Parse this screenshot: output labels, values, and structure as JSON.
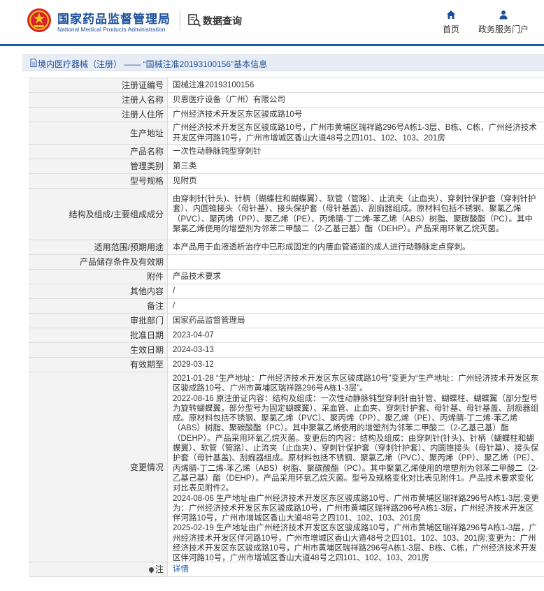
{
  "header": {
    "brand_cn": "国家药品监督管理局",
    "brand_en": "National Medical Products Administration",
    "data_query": "数据查询",
    "nav_home": "首页",
    "nav_service": "政务服务门户",
    "accent": "#1a4f9c"
  },
  "breadcrumb": "境内医疗器械（注册） —— “国械注准20193100156”基本信息",
  "rows": [
    {
      "label": "注册证编号",
      "value": "国械注准20193100156"
    },
    {
      "label": "注册人名称",
      "value": "贝恩医疗设备（广州）有限公司"
    },
    {
      "label": "注册人住所",
      "value": "广州经济技术开发区东区骏成路10号"
    },
    {
      "label": "生产地址",
      "value": "广州经济技术开发区东区骏成路10号，广州市黄埔区瑞祥路296号A栋1-3层、B栋、C栋，广州经济技术开发区伴河路10号，广州市增城区香山大道48号之四101、102、103、201房"
    },
    {
      "label": "产品名称",
      "value": "一次性动静脉钝型穿刺针"
    },
    {
      "label": "管理类别",
      "value": "第三类"
    },
    {
      "label": "型号规格",
      "value": "见附页"
    },
    {
      "label": "结构及组成/主要组成成分",
      "value": "由穿刺针(针头)、针柄（蝴蝶柱和蝴蝶翼）、软管（管路）、止流夹（止血夹）、穿刺针保护套（穿刺针护套）、内圆锥接头（母针基）、接头保护套（母针基盖)、刮痂器组成。原材料包括不锈钢、聚氯乙烯（PVC）、聚丙烯（PP）、聚乙烯（PE）、丙烯腈-丁二烯-苯乙烯（ABS）树脂、聚碳酸酯（PC）。其中聚氯乙烯使用的增塑剂为邻苯二甲酸二（2-乙基己基）酯（DEHP）。产品采用环氧乙烷灭菌。"
    },
    {
      "label": "适用范围/预期用途",
      "value": "本产品用于血液透析治疗中已形成固定的内瘘血管通道的成人进行动静脉定点穿刺。"
    },
    {
      "label": "产品储存条件及有效期",
      "value": ""
    },
    {
      "label": "附件",
      "value": "产品技术要求"
    },
    {
      "label": "其他内容",
      "value": "/"
    },
    {
      "label": "备注",
      "value": "/"
    },
    {
      "label": "审批部门",
      "value": "国家药品监督管理局"
    },
    {
      "label": "批准日期",
      "value": "2023-04-07"
    },
    {
      "label": "生效日期",
      "value": "2024-03-13"
    },
    {
      "label": "有效期至",
      "value": "2029-03-12"
    },
    {
      "label": "变更情况",
      "value": ""
    },
    {
      "label": "注",
      "value": "详情"
    }
  ],
  "changes": [
    "2021-01-28 “生产地址：广州经济技术开发区东区骏成路10号”变更为“生产地址：广州经济技术开发区东区骏成路10号、广州市黄埔区瑞祥路296号A栋1-3层”。",
    "2022-08-16 原注册证内容：结构及组成：一次性动静脉钝型穿刺针由针管、蝴蝶柱、蝴蝶翼（部分型号为旋转蝴蝶翼，部分型号为固定蝴蝶翼）、采血管、止血夹、穿刺针护套、母针基、母针基盖、刮痂器组成。原材料包括不锈钢、聚氯乙烯（PVC）、聚丙烯（PP）、聚乙烯（PE）、丙烯腈-丁二烯-苯乙烯（ABS）树脂、聚碳酸酯（PC）。其中聚氯乙烯使用的增塑剂为邻苯二甲酸二（2-乙基己基）酯（DEHP）。产品采用环氧乙烷灭菌。变更后的内容：结构及组成：由穿刺针(针头)、针柄（蝴蝶柱和蝴蝶翼）、软管（管路）、止流夹（止血夹）、穿刺针保护套（穿刺针护套）、内圆锥接头（母针基）、接头保护套（母针基盖)、刮痂器组成。原材料包括不锈钢、聚氯乙烯（PVC）、聚丙烯（PP）、聚乙烯（PE）、丙烯腈-丁二烯-苯乙烯（ABS）树脂、聚碳酸酯（PC）。其中聚氯乙烯使用的增塑剂为邻苯二甲酸二（2-乙基己基）酯（DEHP）。产品采用环氧乙烷灭菌。型号及规格变化对比表见附件1。产品技术要求变化对比表见附件2。",
    "2024-08-06 生产地址由广州经济技术开发区东区骏成路10号、广州市黄埔区瑞祥路296号A栋1-3层;变更为：广州经济技术开发区东区骏成路10号，广州市黄埔区瑞祥路296号A栋1-3层，广州经济技术开发区伴河路10号，广州市增城区香山大道48号之四101、102、103、201房",
    "2025-02-19 生产地址由广州经济技术开发区东区骏成路10号，广州市黄埔区瑞祥路296号A栋1-3层，广州经济技术开发区伴河路10号，广州市增城区香山大道48号之四101、102、103、201房;变更为：广州经济技术开发区东区骏成路10号，广州市黄埔区瑞祥路296号A栋1-3层、B栋、C栋，广州经济技术开发区伴河路10号，广州市增城区香山大道48号之四101、102、103、201房"
  ]
}
